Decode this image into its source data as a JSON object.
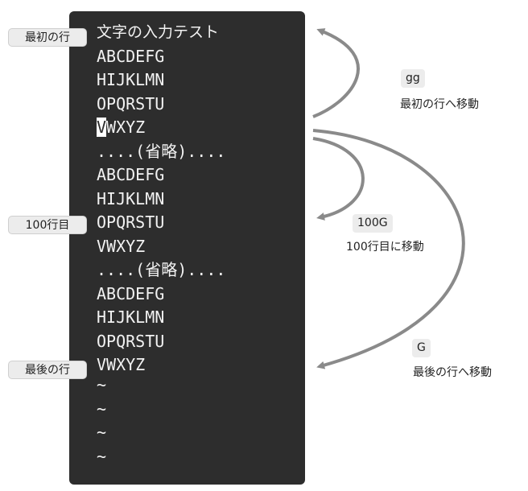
{
  "terminal": {
    "lines": [
      "文字の入力テスト",
      "ABCDEFG",
      "HIJKLMN",
      "OPQRSTU",
      "WXYZ",
      "....(省略)....",
      "ABCDEFG",
      "HIJKLMN",
      "OPQRSTU",
      "VWXYZ",
      "....(省略)....",
      "ABCDEFG",
      "HIJKLMN",
      "OPQRSTU",
      "VWXYZ",
      "~",
      "~",
      "~",
      "~"
    ],
    "cursor_char": "V"
  },
  "row_labels": {
    "first": "最初の行",
    "hundred": "100行目",
    "last": "最後の行"
  },
  "commands": {
    "gg": {
      "key": "gg",
      "desc": "最初の行へ移動"
    },
    "g100": {
      "key": "100G",
      "desc": "100行目に移動"
    },
    "G": {
      "key": "G",
      "desc": "最後の行へ移動"
    }
  },
  "colors": {
    "terminal_bg": "#2d2d2d",
    "terminal_text": "#f2f2f2",
    "arrow": "#8a8a8a",
    "badge_bg": "#ececec"
  }
}
